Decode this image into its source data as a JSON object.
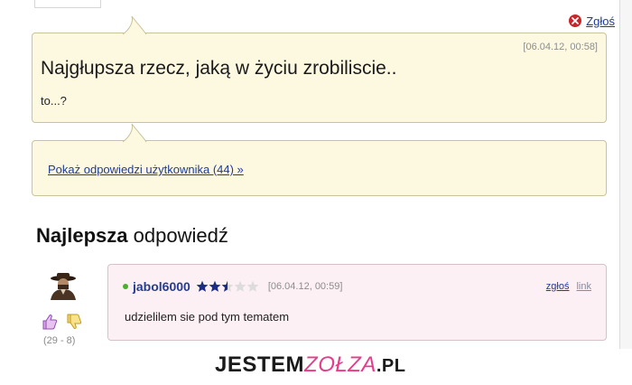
{
  "report_top": {
    "label": "Zgłoś"
  },
  "question": {
    "date": "[06.04.12, 00:58]",
    "title": "Najgłupsza rzecz, jaką w życiu zrobiliscie..",
    "body": "to...?"
  },
  "answers_link": {
    "label": "Pokaż odpowiedzi użytkownika (44) »"
  },
  "best": {
    "heading_bold": "Najlepsza",
    "heading_rest": "odpowiedź"
  },
  "answer": {
    "username": "jabol6000",
    "rating_stars": 2.5,
    "rating_max": 5,
    "date": "[06.04.12, 00:59]",
    "report_label": "zgłoś",
    "link_label": "link",
    "text": "udzielilem sie pod tym tematem",
    "votes": "(29 - 8)"
  },
  "watermark": {
    "part1": "JESTEM",
    "part2": "ZOŁZA",
    "part3": ".PL"
  },
  "colors": {
    "report_red": "#c8262b",
    "star": "#1c2b86",
    "brand_pink": "#e83b8a"
  }
}
